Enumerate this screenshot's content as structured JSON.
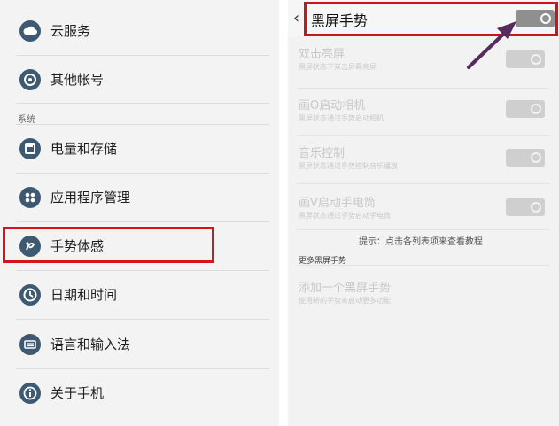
{
  "left": {
    "items_top": [
      {
        "label": "云服务",
        "icon": "cloud-icon"
      },
      {
        "label": "其他帐号",
        "icon": "sync-icon"
      }
    ],
    "section_label": "系统",
    "items_bottom": [
      {
        "label": "电量和存储",
        "icon": "save-icon"
      },
      {
        "label": "应用程序管理",
        "icon": "apps-icon"
      },
      {
        "label": "手势体感",
        "icon": "gesture-icon"
      },
      {
        "label": "日期和时间",
        "icon": "clock-icon"
      },
      {
        "label": "语言和输入法",
        "icon": "keyboard-icon"
      },
      {
        "label": "关于手机",
        "icon": "info-icon"
      }
    ]
  },
  "right": {
    "back_glyph": "‹",
    "title": "黑屏手势",
    "gestures": [
      {
        "title": "双击亮屏",
        "subtitle": "黑屏状态下双击屏幕亮屏"
      },
      {
        "title": "画O启动相机",
        "subtitle": "黑屏状态通过手势启动相机"
      },
      {
        "title": "音乐控制",
        "subtitle": "黑屏状态通过手势控制音乐播放"
      },
      {
        "title": "画V启动手电筒",
        "subtitle": "黑屏状态通过手势启动手电筒"
      }
    ],
    "tip": "提示：点击各列表项来查看教程",
    "more_label": "更多黑屏手势",
    "add_title": "添加一个黑屏手势",
    "add_subtitle": "使用新的手势来启动更多功能"
  },
  "colors": {
    "highlight": "#d3141b",
    "arrow": "#5a2a5e",
    "icon_bg": "#3e5a72"
  }
}
